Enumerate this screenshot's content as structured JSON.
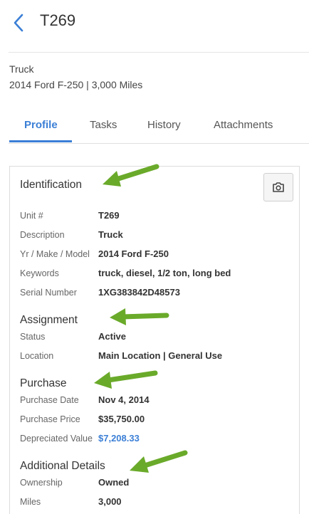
{
  "header": {
    "title": "T269"
  },
  "vehicle": {
    "type": "Truck",
    "summary": "2014 Ford F-250 | 3,000 Miles"
  },
  "tabs": [
    {
      "label": "Profile"
    },
    {
      "label": "Tasks"
    },
    {
      "label": "History"
    },
    {
      "label": "Attachments"
    }
  ],
  "identification": {
    "heading": "Identification",
    "fields": [
      {
        "label": "Unit #",
        "value": "T269"
      },
      {
        "label": "Description",
        "value": "Truck"
      },
      {
        "label": "Yr / Make / Model",
        "value": "2014 Ford F-250"
      },
      {
        "label": "Keywords",
        "value": "truck, diesel, 1/2 ton, long bed"
      },
      {
        "label": "Serial Number",
        "value": "1XG383842D48573"
      }
    ]
  },
  "assignment": {
    "heading": "Assignment",
    "fields": [
      {
        "label": "Status",
        "value": "Active"
      },
      {
        "label": "Location",
        "value": "Main Location | General Use"
      }
    ]
  },
  "purchase": {
    "heading": "Purchase",
    "fields": [
      {
        "label": "Purchase Date",
        "value": "Nov 4, 2014"
      },
      {
        "label": "Purchase Price",
        "value": "$35,750.00"
      },
      {
        "label": "Depreciated Value",
        "value": "$7,208.33"
      }
    ]
  },
  "additional": {
    "heading": "Additional Details",
    "fields": [
      {
        "label": "Ownership",
        "value": "Owned"
      },
      {
        "label": "Miles",
        "value": "3,000"
      }
    ]
  },
  "colors": {
    "accent": "#3b7fd6",
    "annotation_arrow": "#6aaa2a"
  }
}
